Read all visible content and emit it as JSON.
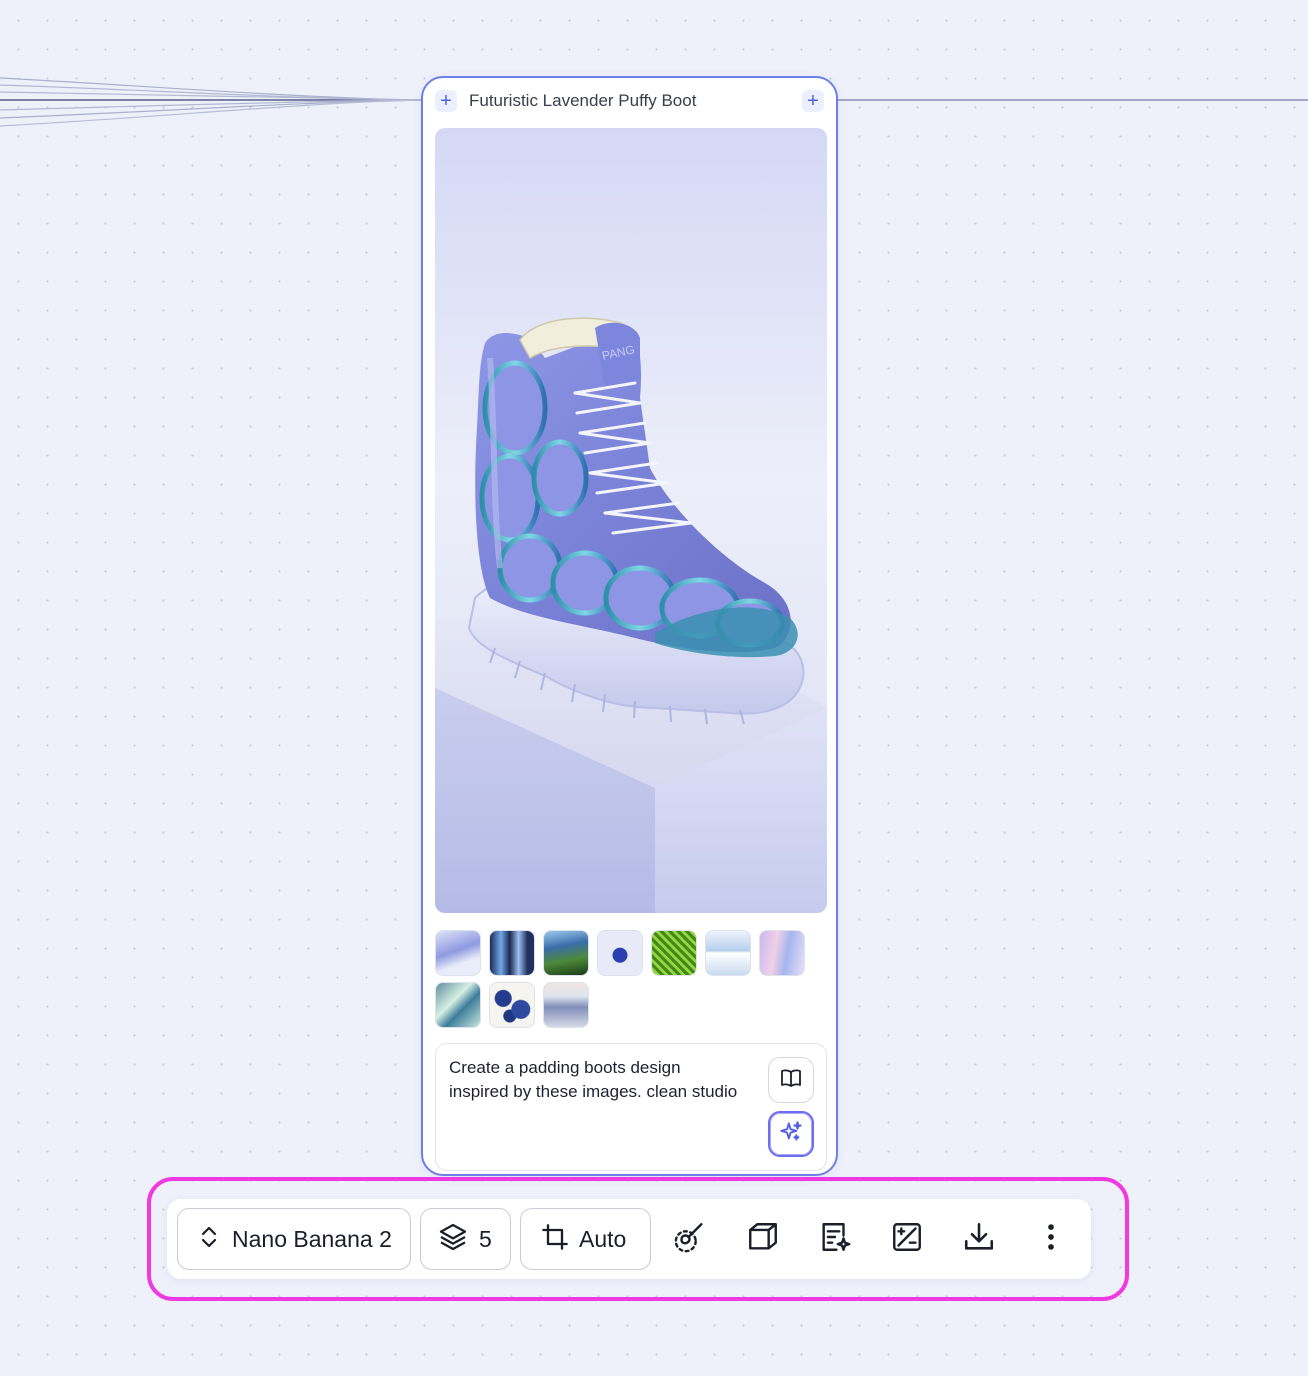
{
  "node": {
    "title": "Futuristic Lavender Puffy Boot",
    "add_left_label": "+",
    "add_right_label": "+",
    "preview_image_icon": "boot-render",
    "reference_thumbnails": [
      {
        "name": "lavender-tool-thumb"
      },
      {
        "name": "denim-jeans-thumb"
      },
      {
        "name": "ocean-landscape-thumb"
      },
      {
        "name": "blue-cube-thumb"
      },
      {
        "name": "green-texture-thumb"
      },
      {
        "name": "poster-thumb"
      },
      {
        "name": "iridescent-fabric-thumb"
      },
      {
        "name": "teal-swirl-thumb"
      },
      {
        "name": "floral-pattern-thumb"
      },
      {
        "name": "knit-sweater-thumb"
      }
    ],
    "prompt": "Create a padding boots design inspired by these images. clean studio",
    "library_icon": "book-icon",
    "generate_icon": "sparkles-icon"
  },
  "toolbar": {
    "model_label": "Nano Banana 2",
    "layers_count": "5",
    "ratio_label": "Auto",
    "icons": [
      "chevron-updown-icon",
      "layers-icon",
      "crop-icon",
      "brush-icon",
      "cube-icon",
      "edit-sparkle-icon",
      "adjust-icon",
      "download-icon",
      "more-icon"
    ]
  },
  "colors": {
    "node_border": "#6e7fe6",
    "highlight": "#f039e0",
    "accent": "#4f63e0",
    "canvas": "#eef0fa"
  }
}
